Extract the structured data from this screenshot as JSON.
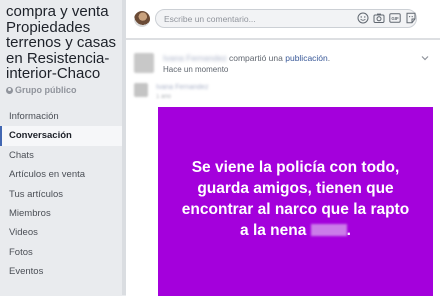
{
  "sidebar": {
    "group_name": "compra y venta Propiedades terrenos y casas en Resistencia-interior-Chaco",
    "group_type": "Grupo público",
    "items": [
      {
        "label": "Información",
        "active": false
      },
      {
        "label": "Conversación",
        "active": true
      },
      {
        "label": "Chats",
        "active": false
      },
      {
        "label": "Artículos en venta",
        "active": false
      },
      {
        "label": "Tus artículos",
        "active": false
      },
      {
        "label": "Miembros",
        "active": false
      },
      {
        "label": "Videos",
        "active": false
      },
      {
        "label": "Fotos",
        "active": false
      },
      {
        "label": "Eventos",
        "active": false
      }
    ]
  },
  "comment_box": {
    "placeholder": "Escribe un comentario...",
    "icons": [
      "emoji-icon",
      "camera-icon",
      "gif-icon",
      "sticker-icon"
    ]
  },
  "post": {
    "author": "Ivana Fernandez",
    "action_text": " compartió una ",
    "action_link": "publicación",
    "action_suffix": ".",
    "time": "Hace un momento",
    "shared_author": "Ivana Fernandez",
    "shared_time": "1 año",
    "media_text": "Se viene la policía con todo, guarda amigos, tienen que encontrar al narco que la rapto a la nena",
    "media_text_end": ".",
    "media_background": "#a400dc"
  },
  "colors": {
    "link": "#385898",
    "active_accent": "#4267b2",
    "page_bg": "#e9ebee"
  }
}
